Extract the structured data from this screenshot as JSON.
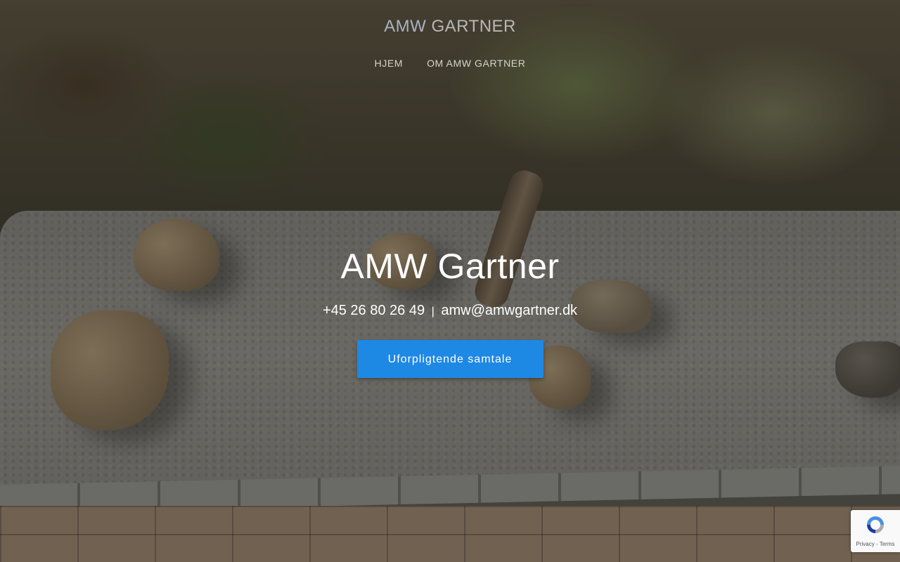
{
  "header": {
    "site_title_part1": "AMW",
    "site_title_part2": "GARTNER",
    "nav": [
      {
        "label": "HJEM"
      },
      {
        "label": "OM AMW GARTNER"
      }
    ]
  },
  "hero": {
    "heading": "AMW Gartner",
    "phone": "+45 26 80 26 49",
    "separator": "|",
    "email": "amw@amwgartner.dk",
    "cta_label": "Uforpligtende samtale"
  },
  "recaptcha": {
    "privacy_label": "Privacy",
    "separator": "-",
    "terms_label": "Terms"
  },
  "colors": {
    "cta_background": "#1e88e5",
    "overlay": "rgba(30,28,24,0.38)",
    "text_primary": "#ffffff"
  }
}
